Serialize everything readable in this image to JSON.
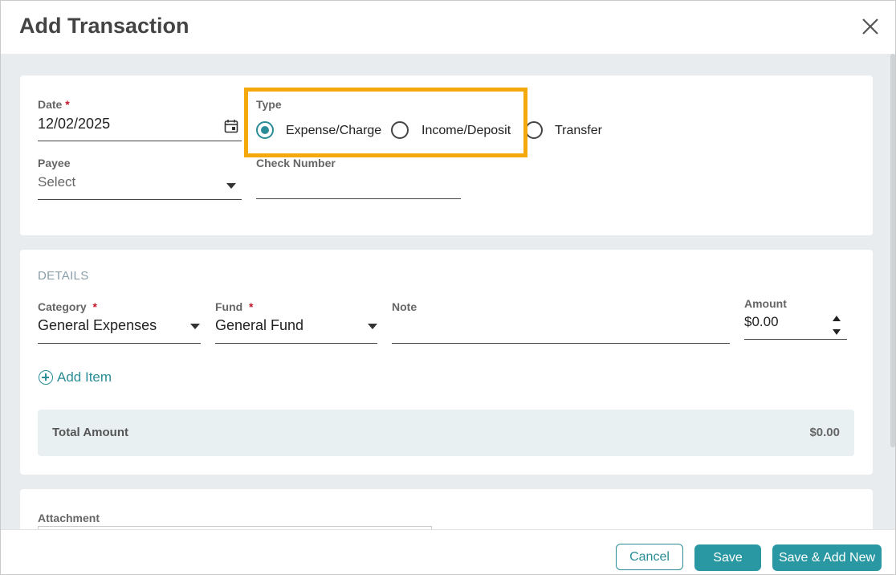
{
  "dialog": {
    "title": "Add Transaction"
  },
  "form": {
    "date": {
      "label": "Date",
      "required_mark": "*",
      "value": "12/02/2025"
    },
    "type": {
      "label": "Type",
      "options": [
        {
          "label": "Expense/Charge",
          "selected": true
        },
        {
          "label": "Income/Deposit",
          "selected": false
        },
        {
          "label": "Transfer",
          "selected": false
        }
      ]
    },
    "payee": {
      "label": "Payee",
      "placeholder": "Select"
    },
    "check_number": {
      "label": "Check Number",
      "value": ""
    }
  },
  "details": {
    "section_title": "DETAILS",
    "category": {
      "label": "Category",
      "required_mark": "*",
      "value": "General Expenses"
    },
    "fund": {
      "label": "Fund",
      "required_mark": "*",
      "value": "General Fund"
    },
    "note": {
      "label": "Note",
      "value": ""
    },
    "amount": {
      "label": "Amount",
      "value": "$0.00"
    },
    "add_item_label": "Add Item",
    "total": {
      "label": "Total Amount",
      "value": "$0.00"
    }
  },
  "attachment": {
    "label": "Attachment"
  },
  "footer": {
    "cancel_label": "Cancel",
    "save_label": "Save",
    "save_new_label": "Save & Add New"
  },
  "colors": {
    "accent": "#2a98a3",
    "highlight": "#f4a80c",
    "required": "#c0182a"
  },
  "icons": {
    "close": "close-icon",
    "calendar": "calendar-icon",
    "dropdown": "chevron-down-icon",
    "add": "plus-circle-icon",
    "spinner": "number-spinner-icon"
  }
}
